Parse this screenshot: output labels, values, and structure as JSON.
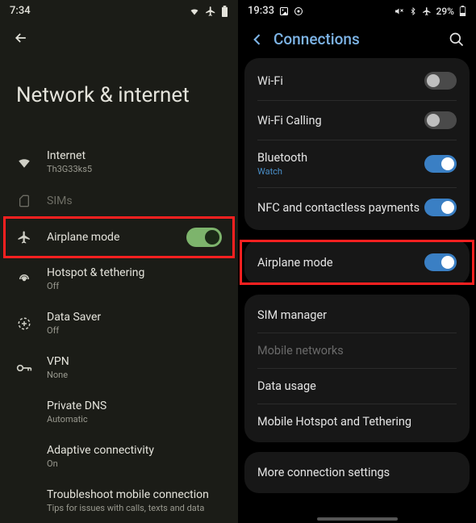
{
  "left": {
    "status": {
      "time": "7:34"
    },
    "title": "Network & internet",
    "items": [
      {
        "label": "Internet",
        "sub": "Th3G33ks5",
        "icon": "wifi",
        "interactable": true
      },
      {
        "label": "SIMs",
        "sub": "",
        "icon": "sim",
        "disabled": true,
        "interactable": true
      },
      {
        "label": "Airplane mode",
        "sub": "",
        "icon": "airplane",
        "toggle": "on",
        "highlight": true,
        "interactable": true
      },
      {
        "label": "Hotspot & tethering",
        "sub": "Off",
        "icon": "hotspot",
        "interactable": true
      },
      {
        "label": "Data Saver",
        "sub": "Off",
        "icon": "datasaver",
        "interactable": true
      },
      {
        "label": "VPN",
        "sub": "None",
        "icon": "vpn",
        "interactable": true
      },
      {
        "label": "Private DNS",
        "sub": "Automatic",
        "icon": "",
        "noicon": true,
        "interactable": true
      },
      {
        "label": "Adaptive connectivity",
        "sub": "On",
        "icon": "",
        "noicon": true,
        "interactable": true
      },
      {
        "label": "Troubleshoot mobile connection",
        "sub": "Tips for issues with calls, texts and data",
        "icon": "",
        "noicon": true,
        "interactable": true
      }
    ]
  },
  "right": {
    "status": {
      "time": "19:33",
      "battery": "29%"
    },
    "title": "Connections",
    "group1": [
      {
        "label": "Wi-Fi",
        "toggle": "off"
      },
      {
        "label": "Wi-Fi Calling",
        "toggle": "off"
      },
      {
        "label": "Bluetooth",
        "sub": "Watch",
        "toggle": "on"
      },
      {
        "label": "NFC and contactless payments",
        "toggle": "on"
      }
    ],
    "airplane": {
      "label": "Airplane mode",
      "toggle": "on"
    },
    "group2": [
      {
        "label": "SIM manager"
      },
      {
        "label": "Mobile networks",
        "disabled": true
      },
      {
        "label": "Data usage"
      },
      {
        "label": "Mobile Hotspot and Tethering"
      }
    ],
    "more": {
      "label": "More connection settings"
    }
  }
}
